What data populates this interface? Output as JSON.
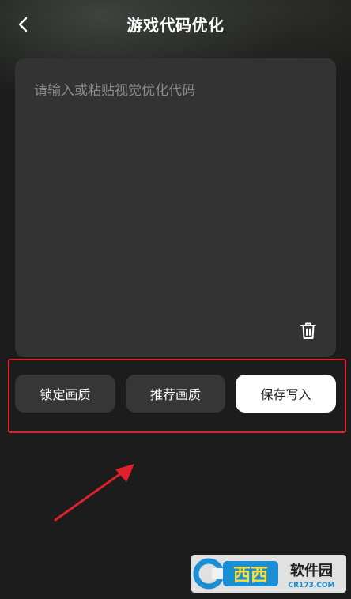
{
  "header": {
    "title": "游戏代码优化",
    "back_icon": "chevron-left-icon"
  },
  "editor": {
    "placeholder": "请输入或粘贴视觉优化代码",
    "value": "",
    "clear_icon": "trash-icon"
  },
  "actions": {
    "lock_quality_label": "锁定画质",
    "recommend_quality_label": "推荐画质",
    "save_write_label": "保存写入"
  },
  "annotation": {
    "highlight_color": "#e0202a",
    "arrow_color": "#e0202a"
  },
  "watermark": {
    "brand": "西西",
    "text": "软件园",
    "site": "CR173.COM"
  },
  "colors": {
    "background": "#1c1c1c",
    "editor_bg": "#333333",
    "button_dark": "#363636",
    "button_light": "#ffffff"
  }
}
